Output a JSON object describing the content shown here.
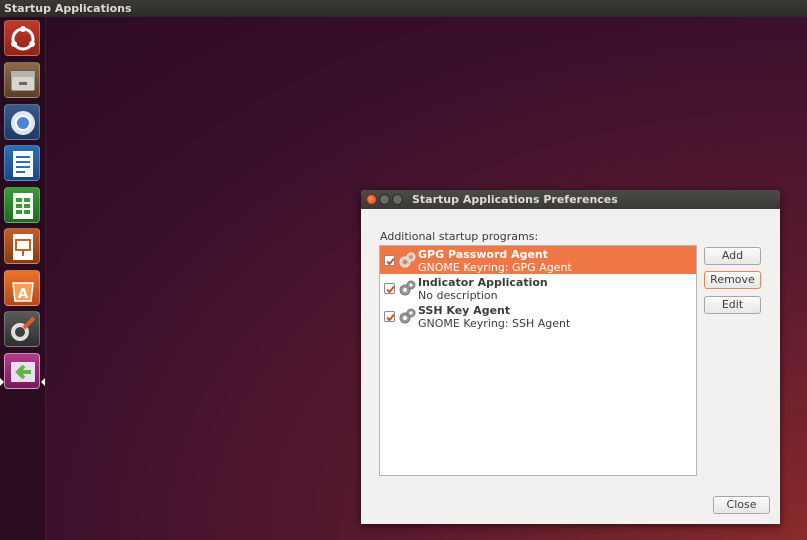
{
  "topbar": {
    "title": "Startup Applications"
  },
  "launcher": {
    "items": [
      {
        "name": "dash-home"
      },
      {
        "name": "files"
      },
      {
        "name": "chromium"
      },
      {
        "name": "libreoffice-writer"
      },
      {
        "name": "libreoffice-calc"
      },
      {
        "name": "libreoffice-impress"
      },
      {
        "name": "software-center"
      },
      {
        "name": "system-settings"
      },
      {
        "name": "startup-applications"
      }
    ]
  },
  "dialog": {
    "title": "Startup Applications Preferences",
    "section_label": "Additional startup programs:",
    "programs": [
      {
        "name": "GPG Password Agent",
        "description": "GNOME Keyring: GPG Agent",
        "enabled": true,
        "selected": true
      },
      {
        "name": "Indicator Application",
        "description": "No description",
        "enabled": true,
        "selected": false
      },
      {
        "name": "SSH Key Agent",
        "description": "GNOME Keyring: SSH Agent",
        "enabled": true,
        "selected": false
      }
    ],
    "buttons": {
      "add": "Add",
      "remove": "Remove",
      "edit": "Edit",
      "close": "Close"
    }
  },
  "colors": {
    "accent": "#f07746",
    "titlebar": "#3c3b37"
  }
}
